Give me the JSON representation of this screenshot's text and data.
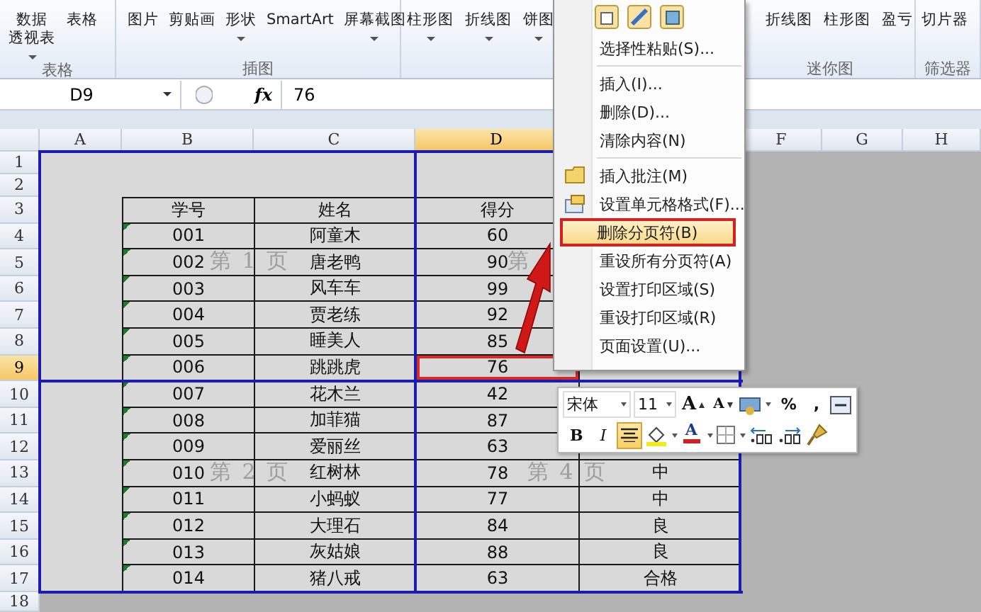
{
  "ribbon": {
    "groups": [
      {
        "label": "表格",
        "buttons": [
          {
            "label_lines": [
              "数据",
              "透视表"
            ],
            "has_menu": true
          },
          {
            "label": "表格",
            "has_menu": false
          }
        ]
      },
      {
        "label": "插图",
        "buttons": [
          {
            "label": "图片",
            "has_menu": false
          },
          {
            "label": "剪贴画",
            "has_menu": false
          },
          {
            "label": "形状",
            "has_menu": true
          },
          {
            "label": "SmartArt",
            "has_menu": false
          },
          {
            "label": "屏幕截图",
            "has_menu": true
          }
        ]
      },
      {
        "buttons": [
          {
            "label": "柱形图",
            "has_menu": true
          },
          {
            "label": "折线图",
            "has_menu": true
          },
          {
            "label": "饼图",
            "has_menu": true
          }
        ]
      },
      {
        "label": "迷你图",
        "buttons": [
          {
            "label": "折线图",
            "has_menu": false
          },
          {
            "label": "柱形图",
            "has_menu": false
          },
          {
            "label": "盈亏",
            "has_menu": false
          }
        ]
      },
      {
        "label": "筛选器",
        "buttons": [
          {
            "label": "切片器",
            "has_menu": false
          }
        ]
      }
    ]
  },
  "formula_bar": {
    "name_box": "D9",
    "fx_label": "fx",
    "value": "76"
  },
  "sheet": {
    "columns": [
      {
        "label": "A",
        "selected": false
      },
      {
        "label": "B",
        "selected": false
      },
      {
        "label": "C",
        "selected": false
      },
      {
        "label": "D",
        "selected": true
      },
      {
        "label": "F",
        "selected": false
      },
      {
        "label": "G",
        "selected": false
      },
      {
        "label": "H",
        "selected": false
      }
    ],
    "row_numbers": [
      {
        "label": "1",
        "selected": false
      },
      {
        "label": "2",
        "selected": false
      },
      {
        "label": "3",
        "selected": false
      },
      {
        "label": "4",
        "selected": false
      },
      {
        "label": "5",
        "selected": false
      },
      {
        "label": "6",
        "selected": false
      },
      {
        "label": "7",
        "selected": false
      },
      {
        "label": "8",
        "selected": false
      },
      {
        "label": "9",
        "selected": true
      },
      {
        "label": "10",
        "selected": false
      },
      {
        "label": "11",
        "selected": false
      },
      {
        "label": "12",
        "selected": false
      },
      {
        "label": "13",
        "selected": false
      },
      {
        "label": "14",
        "selected": false
      },
      {
        "label": "15",
        "selected": false
      },
      {
        "label": "16",
        "selected": false
      },
      {
        "label": "17",
        "selected": false
      },
      {
        "label": "18",
        "selected": false
      }
    ],
    "table": {
      "header": [
        "学号",
        "姓名",
        "得分"
      ],
      "rows": [
        {
          "cells": [
            "001",
            "阿童木",
            "60"
          ],
          "selected": false
        },
        {
          "cells": [
            "002",
            "唐老鸭",
            "90"
          ],
          "selected": false
        },
        {
          "cells": [
            "003",
            "风车车",
            "99"
          ],
          "selected": false
        },
        {
          "cells": [
            "004",
            "贾老练",
            "92"
          ],
          "selected": false
        },
        {
          "cells": [
            "005",
            "睡美人",
            "85"
          ],
          "selected": false
        },
        {
          "cells": [
            "006",
            "跳跳虎",
            "76"
          ],
          "selected": true
        },
        {
          "cells": [
            "007",
            "花木兰",
            "42"
          ],
          "selected": false
        },
        {
          "cells": [
            "008",
            "加菲猫",
            "87"
          ],
          "selected": false
        },
        {
          "cells": [
            "009",
            "爱丽丝",
            "63"
          ],
          "selected": false
        },
        {
          "cells": [
            "010",
            "红树林",
            "78",
            "中"
          ],
          "selected": false
        },
        {
          "cells": [
            "011",
            "小蚂蚁",
            "77",
            "中"
          ],
          "selected": false
        },
        {
          "cells": [
            "012",
            "大理石",
            "84",
            "良"
          ],
          "selected": false
        },
        {
          "cells": [
            "013",
            "灰姑娘",
            "88",
            "良"
          ],
          "selected": false
        },
        {
          "cells": [
            "014",
            "猪八戒",
            "63",
            "合格"
          ],
          "selected": false
        }
      ]
    },
    "page_labels": [
      "第 1 页",
      "第",
      "第 2 页",
      "第 4 页"
    ]
  },
  "context_menu": {
    "sections": [
      [
        {
          "label": "选择性粘贴(S)...",
          "kind": "plain",
          "selected": false
        }
      ],
      [
        {
          "label": "插入(I)...",
          "kind": "plain",
          "selected": false
        },
        {
          "label": "删除(D)...",
          "kind": "plain",
          "selected": false
        },
        {
          "label": "清除内容(N)",
          "kind": "plain",
          "selected": false
        }
      ],
      [
        {
          "label": "插入批注(M)",
          "kind": "comment",
          "selected": false
        },
        {
          "label": "设置单元格格式(F)...",
          "kind": "format",
          "selected": false
        },
        {
          "label": "删除分页符(B)",
          "kind": "plain",
          "selected": true
        },
        {
          "label": "重设所有分页符(A)",
          "kind": "plain",
          "selected": false
        },
        {
          "label": "设置打印区域(S)",
          "kind": "plain",
          "selected": false
        },
        {
          "label": "重设打印区域(R)",
          "kind": "plain",
          "selected": false
        },
        {
          "label": "页面设置(U)...",
          "kind": "plain",
          "selected": false
        }
      ]
    ]
  },
  "mini_toolbar": {
    "rows": [
      [
        {
          "kind": "font",
          "label": "宋体",
          "has_menu": true
        },
        {
          "kind": "size",
          "label": "11",
          "has_menu": true
        },
        {
          "kind": "grow",
          "label": "A",
          "has_menu": false
        },
        {
          "kind": "shrink",
          "label": "A",
          "has_menu": false
        },
        {
          "kind": "accounting",
          "has_menu": true
        },
        {
          "kind": "char",
          "label": "%",
          "has_menu": false
        },
        {
          "kind": "char",
          "label": ",",
          "has_menu": false
        },
        {
          "kind": "merge",
          "has_menu": false
        }
      ],
      [
        {
          "kind": "bold",
          "label": "B",
          "has_menu": false
        },
        {
          "kind": "italic",
          "label": "I",
          "has_menu": false
        },
        {
          "kind": "center",
          "on": true,
          "has_menu": false
        },
        {
          "kind": "fill",
          "has_menu": true
        },
        {
          "kind": "fontcolor",
          "label": "A",
          "has_menu": true
        },
        {
          "kind": "borders",
          "has_menu": true
        },
        {
          "kind": "incdec",
          "has_menu": false
        },
        {
          "kind": "decdec",
          "has_menu": false
        },
        {
          "kind": "brush",
          "has_menu": false
        }
      ]
    ]
  }
}
